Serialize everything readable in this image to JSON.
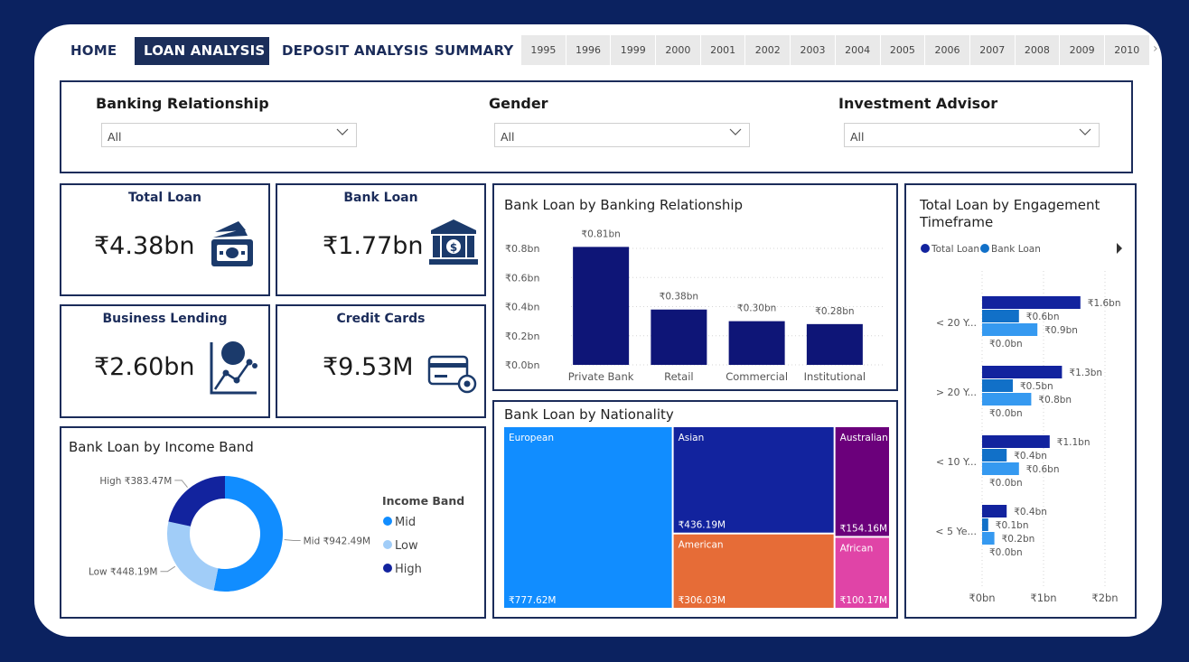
{
  "nav": {
    "home": "HOME",
    "loan_analysis": "LOAN ANALYSIS",
    "deposit_analysis": "DEPOSIT ANALYSIS",
    "summary": "SUMMARY",
    "years": [
      "1995",
      "1996",
      "1999",
      "2000",
      "2001",
      "2002",
      "2003",
      "2004",
      "2005",
      "2006",
      "2007",
      "2008",
      "2009",
      "2010"
    ]
  },
  "filters": {
    "banking_relationship": {
      "label": "Banking Relationship",
      "value": "All"
    },
    "gender": {
      "label": "Gender",
      "value": "All"
    },
    "investment_advisor": {
      "label": "Investment Advisor",
      "value": "All"
    }
  },
  "kpis": {
    "total_loan": {
      "title": "Total Loan",
      "value": "₹4.38bn",
      "icon": "cash-icon"
    },
    "bank_loan": {
      "title": "Bank Loan",
      "value": "₹1.77bn",
      "icon": "bank-icon"
    },
    "business_lending": {
      "title": "Business Lending",
      "value": "₹2.60bn",
      "icon": "growth-chart-icon"
    },
    "credit_cards": {
      "title": "Credit Cards",
      "value": "₹9.53M",
      "icon": "credit-card-icon"
    }
  },
  "colors": {
    "navy": "#0e1577",
    "nav_active": "#1b2e5a",
    "mid": "#118dff",
    "low": "#a1cdf8",
    "high": "#12239e",
    "european": "#118dff",
    "asian": "#12239e",
    "australian": "#6b007b",
    "american": "#e66c37",
    "african": "#e044a7",
    "total_loan": "#12239e",
    "bank_loan_series": "#1170c8",
    "third_series": "#3599f0"
  },
  "chart_data": [
    {
      "id": "bank-loan-by-banking-relationship",
      "type": "bar",
      "title": "Bank Loan by Banking Relationship",
      "categories": [
        "Private Bank",
        "Retail",
        "Commercial",
        "Institutional"
      ],
      "values": [
        0.81,
        0.38,
        0.3,
        0.28
      ],
      "data_labels": [
        "₹0.81bn",
        "₹0.38bn",
        "₹0.30bn",
        "₹0.28bn"
      ],
      "yticks": [
        "₹0.0bn",
        "₹0.2bn",
        "₹0.4bn",
        "₹0.6bn",
        "₹0.8bn"
      ],
      "ylim": [
        0,
        0.8
      ]
    },
    {
      "id": "bank-loan-by-income-band",
      "type": "pie",
      "title": "Bank Loan by Income Band",
      "legend_title": "Income Band",
      "categories": [
        "Mid",
        "Low",
        "High"
      ],
      "values": [
        942.49,
        448.19,
        383.47
      ],
      "data_labels": [
        "Mid ₹942.49M",
        "Low ₹448.19M",
        "High ₹383.47M"
      ]
    },
    {
      "id": "bank-loan-by-nationality",
      "type": "treemap",
      "title": "Bank Loan by Nationality",
      "categories": [
        "European",
        "Asian",
        "Australian",
        "American",
        "African"
      ],
      "values": [
        777.62,
        436.19,
        154.16,
        306.03,
        100.17
      ],
      "data_labels": [
        "₹777.62M",
        "₹436.19M",
        "₹154.16M",
        "₹306.03M",
        "₹100.17M"
      ]
    },
    {
      "id": "total-loan-by-engagement-timeframe",
      "type": "bar",
      "orientation": "horizontal",
      "title": "Total Loan by Engagement Timeframe",
      "categories": [
        "< 20 Y...",
        "> 20 Y...",
        "< 10 Y...",
        "< 5 Ye..."
      ],
      "legend": [
        "Total Loan",
        "Bank Loan"
      ],
      "series": [
        {
          "name": "Total Loan",
          "values": [
            1.6,
            1.3,
            1.1,
            0.4
          ],
          "labels": [
            "₹1.6bn",
            "₹1.3bn",
            "₹1.1bn",
            "₹0.4bn"
          ]
        },
        {
          "name": "Bank Loan",
          "values": [
            0.6,
            0.5,
            0.4,
            0.1
          ],
          "labels": [
            "₹0.6bn",
            "₹0.5bn",
            "₹0.4bn",
            "₹0.1bn"
          ]
        },
        {
          "values": [
            0.9,
            0.8,
            0.6,
            0.2
          ],
          "labels": [
            "₹0.9bn",
            "₹0.8bn",
            "₹0.6bn",
            "₹0.2bn"
          ]
        },
        {
          "values": [
            0.0,
            0.0,
            0.0,
            0.0
          ],
          "labels": [
            "₹0.0bn",
            "₹0.0bn",
            "₹0.0bn",
            "₹0.0bn"
          ]
        }
      ],
      "xticks": [
        "₹0bn",
        "₹1bn",
        "₹2bn"
      ],
      "xlim": [
        0,
        2
      ]
    }
  ]
}
